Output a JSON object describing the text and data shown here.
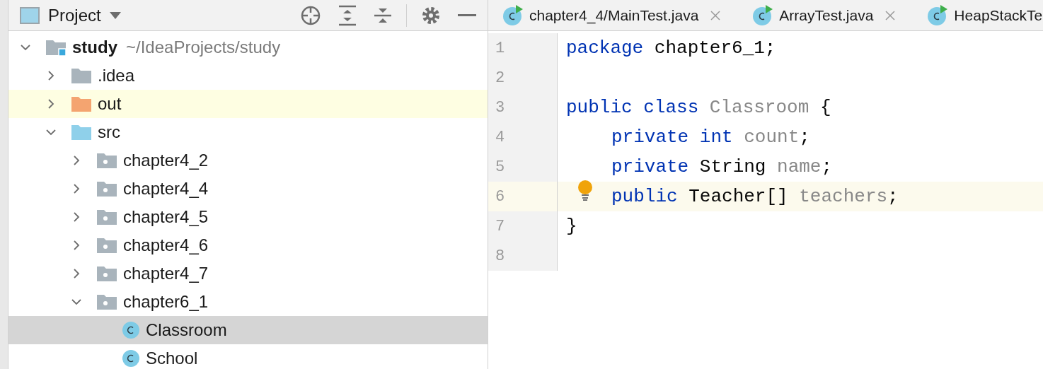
{
  "project_panel": {
    "title": "Project",
    "tree": [
      {
        "name": "study",
        "path": "~/IdeaProjects/study",
        "kind": "module",
        "expanded": true,
        "selected": false,
        "highlighted": false,
        "children": [
          {
            "name": ".idea",
            "kind": "folder",
            "expanded": false,
            "selected": false,
            "highlighted": false
          },
          {
            "name": "out",
            "kind": "excluded-folder",
            "expanded": false,
            "selected": false,
            "highlighted": true
          },
          {
            "name": "src",
            "kind": "source-folder",
            "expanded": true,
            "selected": false,
            "highlighted": false,
            "children": [
              {
                "name": "chapter4_2",
                "kind": "package",
                "expanded": false,
                "selected": false,
                "highlighted": false
              },
              {
                "name": "chapter4_4",
                "kind": "package",
                "expanded": false,
                "selected": false,
                "highlighted": false
              },
              {
                "name": "chapter4_5",
                "kind": "package",
                "expanded": false,
                "selected": false,
                "highlighted": false
              },
              {
                "name": "chapter4_6",
                "kind": "package",
                "expanded": false,
                "selected": false,
                "highlighted": false
              },
              {
                "name": "chapter4_7",
                "kind": "package",
                "expanded": false,
                "selected": false,
                "highlighted": false
              },
              {
                "name": "chapter6_1",
                "kind": "package",
                "expanded": true,
                "selected": false,
                "highlighted": false,
                "children": [
                  {
                    "name": "Classroom",
                    "kind": "class",
                    "selected": true,
                    "highlighted": false
                  },
                  {
                    "name": "School",
                    "kind": "class",
                    "selected": false,
                    "highlighted": false
                  }
                ]
              }
            ]
          }
        ]
      }
    ]
  },
  "editor": {
    "tabs": [
      {
        "label": "chapter4_4/MainTest.java",
        "closable": true,
        "selected": false
      },
      {
        "label": "ArrayTest.java",
        "closable": true,
        "selected": false
      },
      {
        "label": "HeapStackTe",
        "selected": false
      }
    ],
    "lines": [
      {
        "number": "1",
        "current": false,
        "bulb": false,
        "indent": false,
        "tokens": [
          {
            "text": "package ",
            "kind": "keyword"
          },
          {
            "text": "chapter6_1;",
            "kind": "plain"
          }
        ]
      },
      {
        "number": "2",
        "current": false,
        "bulb": false,
        "indent": false
      },
      {
        "number": "3",
        "current": false,
        "bulb": false,
        "indent": false,
        "tokens": [
          {
            "text": "public class ",
            "kind": "keyword"
          },
          {
            "text": "Classroom",
            "kind": "unused"
          },
          {
            "text": " {",
            "kind": "plain"
          }
        ]
      },
      {
        "number": "4",
        "current": false,
        "bulb": false,
        "indent": true,
        "tokens": [
          {
            "text": "private int ",
            "kind": "keyword"
          },
          {
            "text": "count",
            "kind": "unused"
          },
          {
            "text": ";",
            "kind": "plain"
          }
        ]
      },
      {
        "number": "5",
        "current": false,
        "bulb": false,
        "indent": true,
        "tokens": [
          {
            "text": "private",
            "kind": "keyword"
          },
          {
            "text": " String ",
            "kind": "plain"
          },
          {
            "text": "name",
            "kind": "unused"
          },
          {
            "text": ";",
            "kind": "plain"
          }
        ]
      },
      {
        "number": "6",
        "current": true,
        "bulb": true,
        "indent": true,
        "tokens": [
          {
            "text": "public",
            "kind": "keyword"
          },
          {
            "text": " Teacher[] ",
            "kind": "plain"
          },
          {
            "text": "teachers",
            "kind": "unused"
          },
          {
            "text": ";",
            "kind": "plain"
          }
        ]
      },
      {
        "number": "7",
        "current": false,
        "bulb": false,
        "indent": false,
        "tokens": [
          {
            "text": "}",
            "kind": "plain"
          }
        ]
      },
      {
        "number": "8",
        "current": false,
        "bulb": false,
        "indent": false
      }
    ]
  }
}
